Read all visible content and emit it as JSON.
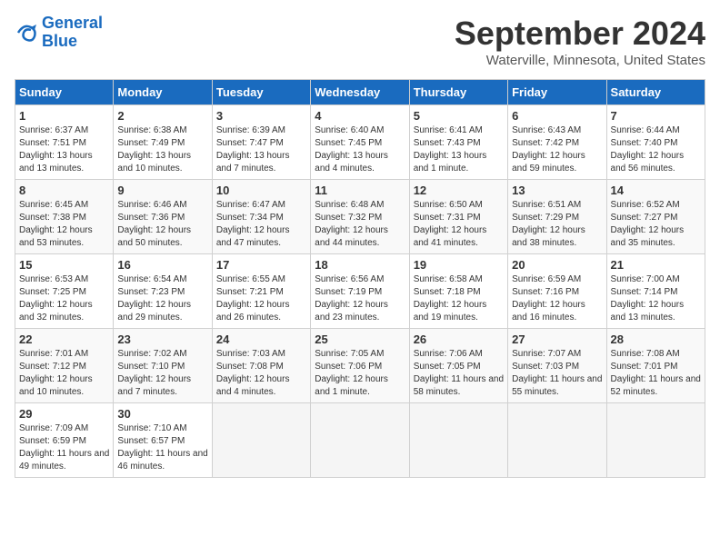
{
  "header": {
    "logo_line1": "General",
    "logo_line2": "Blue",
    "month_title": "September 2024",
    "location": "Waterville, Minnesota, United States"
  },
  "days_of_week": [
    "Sunday",
    "Monday",
    "Tuesday",
    "Wednesday",
    "Thursday",
    "Friday",
    "Saturday"
  ],
  "weeks": [
    [
      {
        "day": "1",
        "detail": "Sunrise: 6:37 AM\nSunset: 7:51 PM\nDaylight: 13 hours\nand 13 minutes."
      },
      {
        "day": "2",
        "detail": "Sunrise: 6:38 AM\nSunset: 7:49 PM\nDaylight: 13 hours\nand 10 minutes."
      },
      {
        "day": "3",
        "detail": "Sunrise: 6:39 AM\nSunset: 7:47 PM\nDaylight: 13 hours\nand 7 minutes."
      },
      {
        "day": "4",
        "detail": "Sunrise: 6:40 AM\nSunset: 7:45 PM\nDaylight: 13 hours\nand 4 minutes."
      },
      {
        "day": "5",
        "detail": "Sunrise: 6:41 AM\nSunset: 7:43 PM\nDaylight: 13 hours\nand 1 minute."
      },
      {
        "day": "6",
        "detail": "Sunrise: 6:43 AM\nSunset: 7:42 PM\nDaylight: 12 hours\nand 59 minutes."
      },
      {
        "day": "7",
        "detail": "Sunrise: 6:44 AM\nSunset: 7:40 PM\nDaylight: 12 hours\nand 56 minutes."
      }
    ],
    [
      {
        "day": "8",
        "detail": "Sunrise: 6:45 AM\nSunset: 7:38 PM\nDaylight: 12 hours\nand 53 minutes."
      },
      {
        "day": "9",
        "detail": "Sunrise: 6:46 AM\nSunset: 7:36 PM\nDaylight: 12 hours\nand 50 minutes."
      },
      {
        "day": "10",
        "detail": "Sunrise: 6:47 AM\nSunset: 7:34 PM\nDaylight: 12 hours\nand 47 minutes."
      },
      {
        "day": "11",
        "detail": "Sunrise: 6:48 AM\nSunset: 7:32 PM\nDaylight: 12 hours\nand 44 minutes."
      },
      {
        "day": "12",
        "detail": "Sunrise: 6:50 AM\nSunset: 7:31 PM\nDaylight: 12 hours\nand 41 minutes."
      },
      {
        "day": "13",
        "detail": "Sunrise: 6:51 AM\nSunset: 7:29 PM\nDaylight: 12 hours\nand 38 minutes."
      },
      {
        "day": "14",
        "detail": "Sunrise: 6:52 AM\nSunset: 7:27 PM\nDaylight: 12 hours\nand 35 minutes."
      }
    ],
    [
      {
        "day": "15",
        "detail": "Sunrise: 6:53 AM\nSunset: 7:25 PM\nDaylight: 12 hours\nand 32 minutes."
      },
      {
        "day": "16",
        "detail": "Sunrise: 6:54 AM\nSunset: 7:23 PM\nDaylight: 12 hours\nand 29 minutes."
      },
      {
        "day": "17",
        "detail": "Sunrise: 6:55 AM\nSunset: 7:21 PM\nDaylight: 12 hours\nand 26 minutes."
      },
      {
        "day": "18",
        "detail": "Sunrise: 6:56 AM\nSunset: 7:19 PM\nDaylight: 12 hours\nand 23 minutes."
      },
      {
        "day": "19",
        "detail": "Sunrise: 6:58 AM\nSunset: 7:18 PM\nDaylight: 12 hours\nand 19 minutes."
      },
      {
        "day": "20",
        "detail": "Sunrise: 6:59 AM\nSunset: 7:16 PM\nDaylight: 12 hours\nand 16 minutes."
      },
      {
        "day": "21",
        "detail": "Sunrise: 7:00 AM\nSunset: 7:14 PM\nDaylight: 12 hours\nand 13 minutes."
      }
    ],
    [
      {
        "day": "22",
        "detail": "Sunrise: 7:01 AM\nSunset: 7:12 PM\nDaylight: 12 hours\nand 10 minutes."
      },
      {
        "day": "23",
        "detail": "Sunrise: 7:02 AM\nSunset: 7:10 PM\nDaylight: 12 hours\nand 7 minutes."
      },
      {
        "day": "24",
        "detail": "Sunrise: 7:03 AM\nSunset: 7:08 PM\nDaylight: 12 hours\nand 4 minutes."
      },
      {
        "day": "25",
        "detail": "Sunrise: 7:05 AM\nSunset: 7:06 PM\nDaylight: 12 hours\nand 1 minute."
      },
      {
        "day": "26",
        "detail": "Sunrise: 7:06 AM\nSunset: 7:05 PM\nDaylight: 11 hours\nand 58 minutes."
      },
      {
        "day": "27",
        "detail": "Sunrise: 7:07 AM\nSunset: 7:03 PM\nDaylight: 11 hours\nand 55 minutes."
      },
      {
        "day": "28",
        "detail": "Sunrise: 7:08 AM\nSunset: 7:01 PM\nDaylight: 11 hours\nand 52 minutes."
      }
    ],
    [
      {
        "day": "29",
        "detail": "Sunrise: 7:09 AM\nSunset: 6:59 PM\nDaylight: 11 hours\nand 49 minutes."
      },
      {
        "day": "30",
        "detail": "Sunrise: 7:10 AM\nSunset: 6:57 PM\nDaylight: 11 hours\nand 46 minutes."
      },
      {
        "day": "",
        "detail": ""
      },
      {
        "day": "",
        "detail": ""
      },
      {
        "day": "",
        "detail": ""
      },
      {
        "day": "",
        "detail": ""
      },
      {
        "day": "",
        "detail": ""
      }
    ]
  ]
}
